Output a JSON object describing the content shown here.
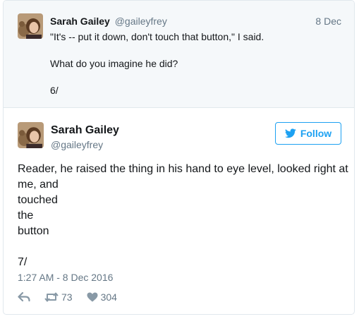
{
  "parent_tweet": {
    "name": "Sarah Gailey",
    "handle": "@gaileyfrey",
    "date": "8 Dec",
    "lines": [
      "\"It's -- put it down, don't touch that button,\" I said.",
      "",
      "What do you imagine he did?",
      "",
      "6/"
    ]
  },
  "main_tweet": {
    "name": "Sarah Gailey",
    "handle": "@gaileyfrey",
    "follow_label": "Follow",
    "lines": [
      "Reader, he raised the thing in his hand to eye level, looked right at me, and",
      "touched",
      "the",
      "button",
      "",
      "7/"
    ],
    "timestamp": "1:27 AM - 8 Dec 2016",
    "retweets": "73",
    "likes": "304"
  },
  "icons": {
    "reply": "reply-icon",
    "retweet": "retweet-icon",
    "like": "heart-icon",
    "follow": "twitter-bird-icon"
  },
  "colors": {
    "accent": "#1da1f2",
    "muted": "#657786",
    "text": "#14171a",
    "parent_bg": "#f5f8fa"
  }
}
